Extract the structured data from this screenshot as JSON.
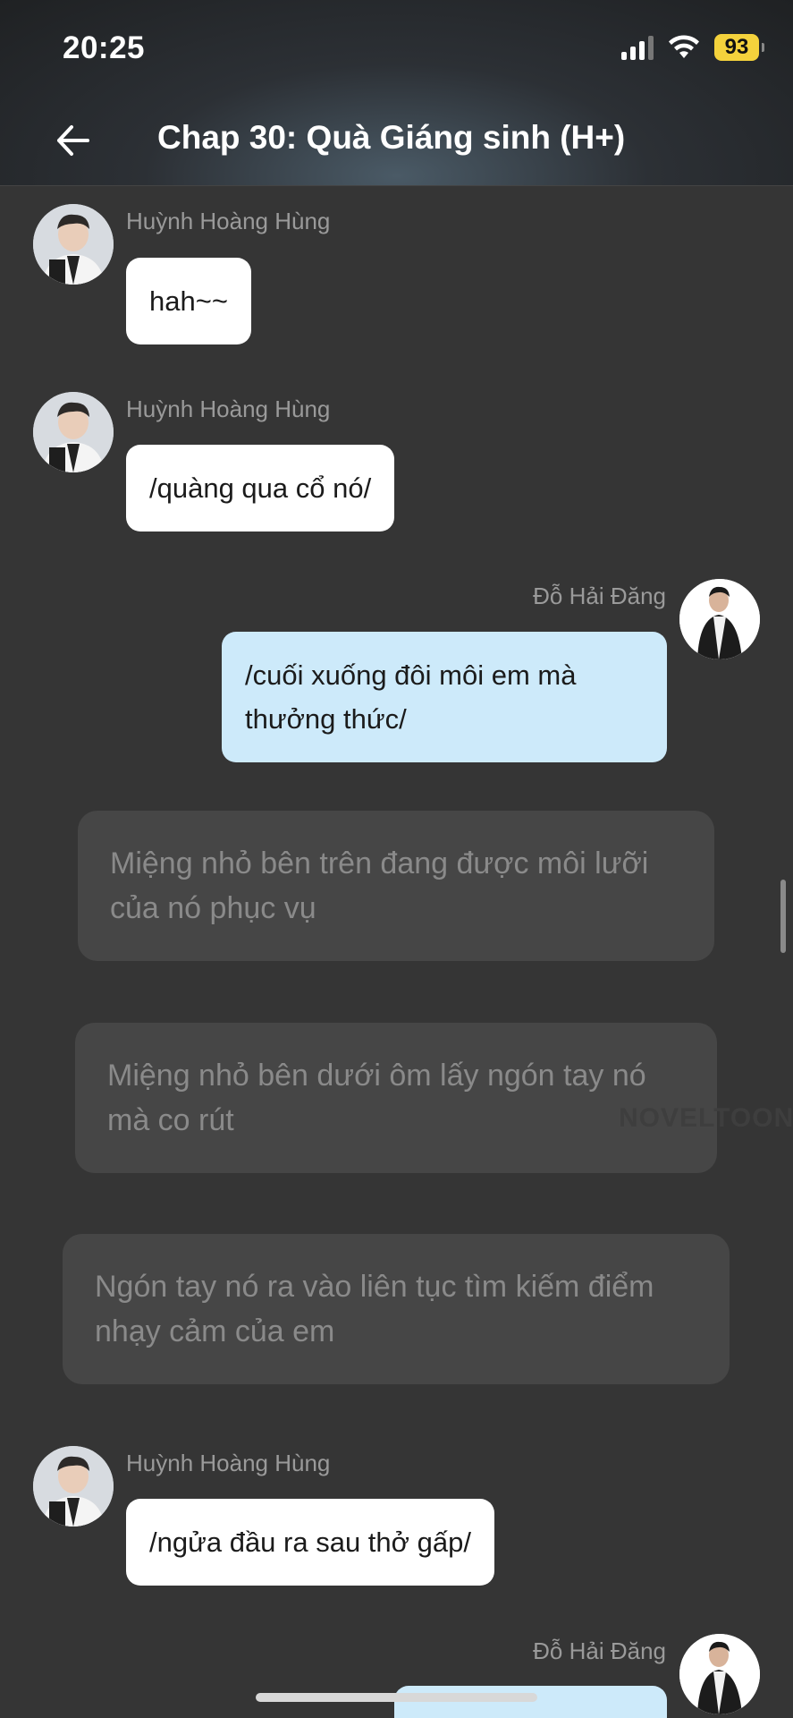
{
  "status_bar": {
    "time": "20:25",
    "battery": "93"
  },
  "header": {
    "title": "Chap 30: Quà Giáng sinh (H+)"
  },
  "messages": [
    {
      "sender": "Huỳnh Hoàng Hùng",
      "text": "hah~~"
    },
    {
      "sender": "Huỳnh Hoàng Hùng",
      "text": "/quàng qua cổ nó/"
    },
    {
      "sender": "Đỗ Hải Đăng",
      "text": "/cuối xuống đôi môi em mà thưởng thức/"
    },
    {
      "narration": "Miệng nhỏ bên trên đang được môi lưỡi của nó phục vụ"
    },
    {
      "narration": "Miệng nhỏ bên dưới ôm lấy ngón tay nó mà co rút"
    },
    {
      "narration": "Ngón tay nó ra vào liên tục tìm kiếm điểm nhạy cảm của em"
    },
    {
      "sender": "Huỳnh Hoàng Hùng",
      "text": "/ngửa đầu ra sau thở gấp/"
    },
    {
      "sender": "Đỗ Hải Đăng",
      "text": ""
    }
  ],
  "watermark": "NOVELTOON",
  "icons": {
    "back": "arrow-left-icon",
    "signal": "cellular-signal-icon",
    "wifi": "wifi-icon",
    "battery": "battery-icon"
  },
  "colors": {
    "background": "#353535",
    "bubble_left": "#ffffff",
    "bubble_right": "#cdeafa",
    "narration": "#464646",
    "battery": "#f4d23c"
  }
}
